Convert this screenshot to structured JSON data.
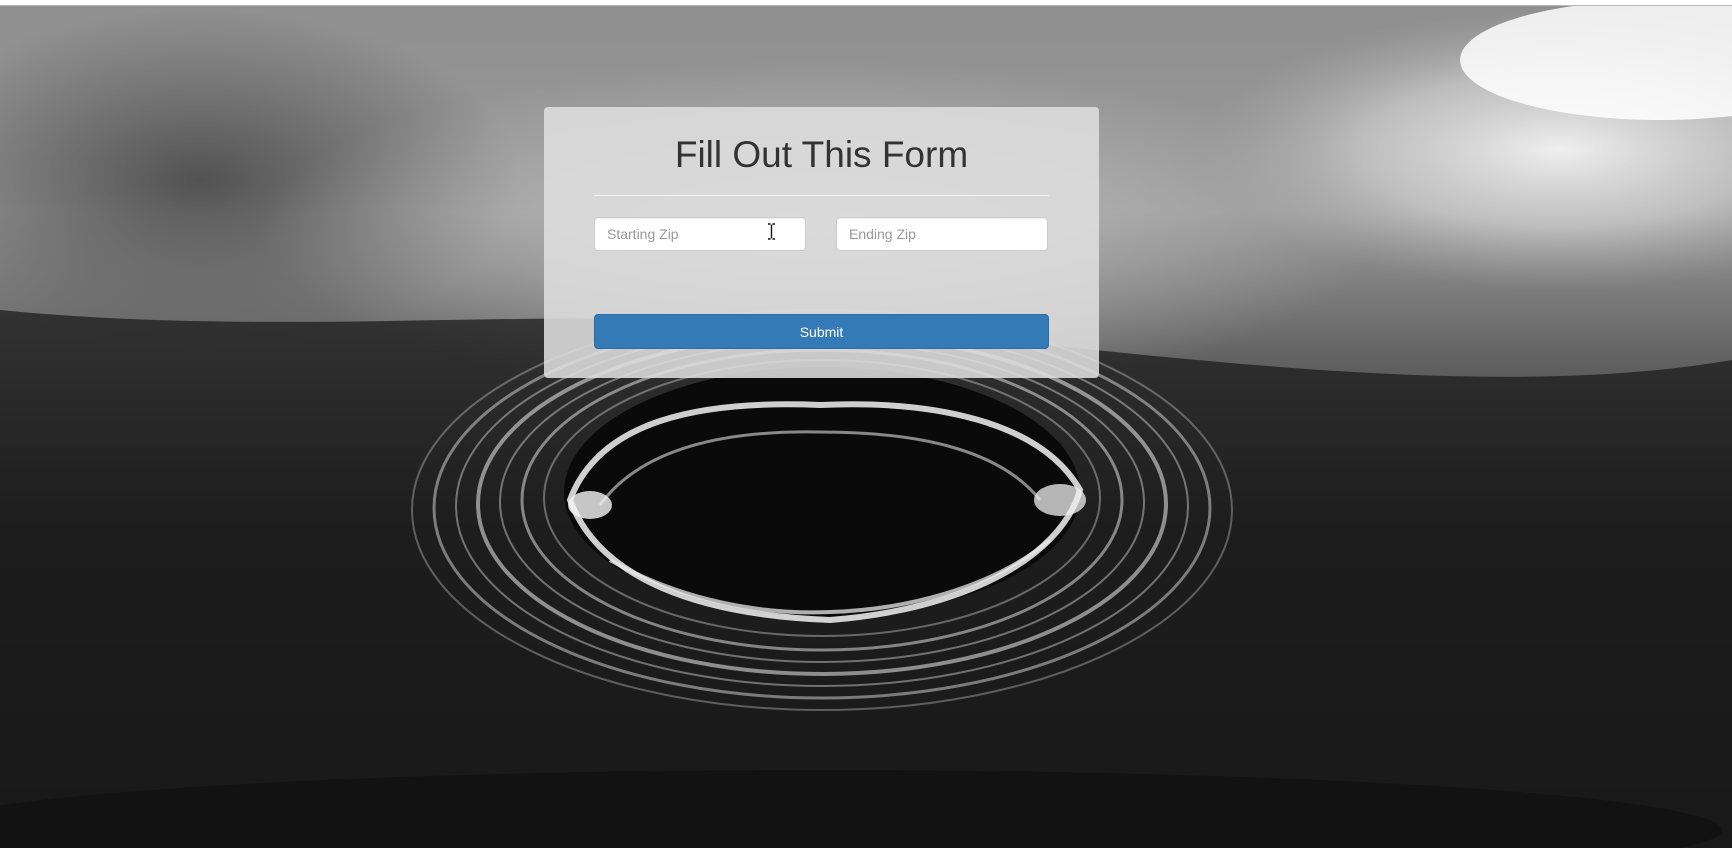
{
  "form": {
    "title": "Fill Out This Form",
    "starting_zip": {
      "placeholder": "Starting Zip",
      "value": ""
    },
    "ending_zip": {
      "placeholder": "Ending Zip",
      "value": ""
    },
    "submit_label": "Submit"
  },
  "background": {
    "image": "water-droplet-ripple",
    "tone": "grayscale"
  },
  "colors": {
    "card_background": "#dedede",
    "title_text": "#333333",
    "input_border": "#cccccc",
    "placeholder_text": "#999999",
    "submit_background": "#337ab7",
    "submit_border": "#2e6da4",
    "submit_text": "#ffffff"
  },
  "icons": {
    "text_cursor": "i-beam-cursor-icon"
  }
}
